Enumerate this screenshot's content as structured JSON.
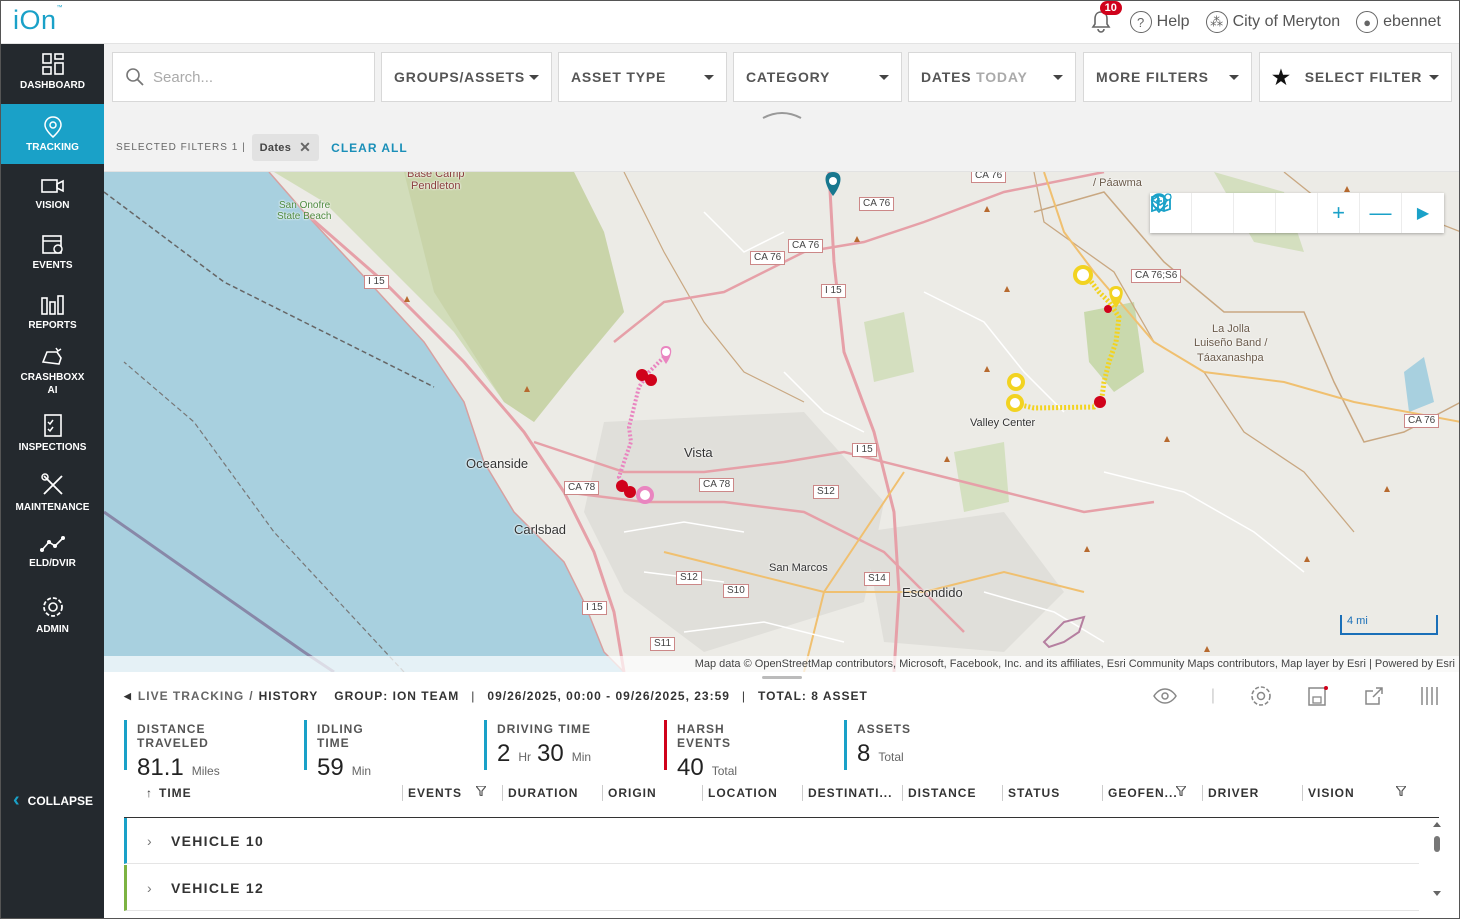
{
  "app": {
    "logo": "iOn",
    "logo_mark": "™"
  },
  "topbar": {
    "notification_count": "10",
    "help": "Help",
    "org": "City of Meryton",
    "user": "ebennet"
  },
  "sidebar": {
    "items": [
      {
        "label": "DASHBOARD",
        "icon": "dashboard-icon"
      },
      {
        "label": "TRACKING",
        "icon": "location-icon",
        "active": true
      },
      {
        "label": "VISION",
        "icon": "camera-icon"
      },
      {
        "label": "EVENTS",
        "icon": "calendar-icon"
      },
      {
        "label": "REPORTS",
        "icon": "reports-icon"
      },
      {
        "label": "CRASHBOXX",
        "label2": "AI",
        "icon": "crash-icon"
      },
      {
        "label": "INSPECTIONS",
        "icon": "checklist-icon"
      },
      {
        "label": "MAINTENANCE",
        "icon": "tools-icon"
      },
      {
        "label": "ELD/DVIR",
        "icon": "route-icon"
      },
      {
        "label": "ADMIN",
        "icon": "gear-icon"
      }
    ],
    "collapse": "COLLAPSE"
  },
  "filters": {
    "search_placeholder": "Search...",
    "groups": "GROUPS/ASSETS",
    "asset_type": "ASSET TYPE",
    "category": "CATEGORY",
    "dates": "DATES",
    "dates_value": "TODAY",
    "more": "MORE FILTERS",
    "select_filter": "SELECT FILTER"
  },
  "selected": {
    "label": "SELECTED FILTERS 1 |",
    "chip": "Dates",
    "clear": "CLEAR ALL"
  },
  "map": {
    "labels": {
      "base_camp": "Base Camp",
      "pendleton": "Pendleton",
      "san_onofre": "San Onofre",
      "state_beach": "State Beach",
      "oceanside": "Oceanside",
      "vista": "Vista",
      "carlsbad": "Carlsbad",
      "san_marcos": "San Marcos",
      "escondido": "Escondido",
      "valley_center": "Valley Center",
      "la_jolla_1": "La Jolla",
      "la_jolla_2": "Luiseño Band /",
      "la_jolla_3": "Táaxanashpa",
      "paawma": "/ Páawma"
    },
    "roads": {
      "i15a": "I 15",
      "i15b": "I 15",
      "i15c": "I 15",
      "i15d": "I 15",
      "ca76a": "CA 76",
      "ca76b": "CA 76",
      "ca76c": "CA 76",
      "ca76d": "CA 76",
      "ca76s6": "CA 76;S6",
      "ca76e": "CA 76",
      "ca78a": "CA 78",
      "ca78b": "CA 78",
      "s12a": "S12",
      "s12b": "S12",
      "s10": "S10",
      "s14": "S14",
      "s11": "S11"
    },
    "scale": "4 mi",
    "attribution": "Map data © OpenStreetMap contributors, Microsoft, Facebook, Inc. and its affiliates, Esri Community Maps contributors, Map layer by Esri",
    "powered": "Powered by Esri",
    "colors": {
      "water": "#a8d0df",
      "land": "#ecebe6",
      "green": "#cfdcb5",
      "route_pink": "#e985c0",
      "route_yellow": "#f2d321",
      "event_red": "#d0021b",
      "marker_teal": "#18788f"
    }
  },
  "bottom": {
    "breadcrumb_live": "LIVE TRACKING",
    "breadcrumb_sep": "/",
    "breadcrumb_history": "HISTORY",
    "group": "GROUP: ION TEAM",
    "range": "09/26/2025, 00:00 - 09/26/2025, 23:59",
    "total": "TOTAL: 8 ASSET",
    "stats": [
      {
        "label": "DISTANCE TRAVELED",
        "value": "81.1",
        "unit": "Miles",
        "color": "#1aa1c8"
      },
      {
        "label": "IDLING TIME",
        "value": "59",
        "unit": "Min",
        "color": "#1aa1c8"
      },
      {
        "label": "DRIVING TIME",
        "value": "2",
        "unit": "Hr",
        "value2": "30",
        "unit2": "Min",
        "color": "#1aa1c8"
      },
      {
        "label": "HARSH EVENTS",
        "value": "40",
        "unit": "Total",
        "color": "#d0021b"
      },
      {
        "label": "ASSETS",
        "value": "8",
        "unit": "Total",
        "color": "#1aa1c8"
      }
    ],
    "columns": [
      "TIME",
      "EVENTS",
      "DURATION",
      "ORIGIN",
      "LOCATION",
      "DESTINATI...",
      "DISTANCE",
      "STATUS",
      "GEOFEN...",
      "DRIVER",
      "VISION"
    ],
    "rows": [
      {
        "name": "VEHICLE 10",
        "color": "#1aa1c8"
      },
      {
        "name": "VEHICLE 12",
        "color": "#7cb342"
      }
    ]
  }
}
